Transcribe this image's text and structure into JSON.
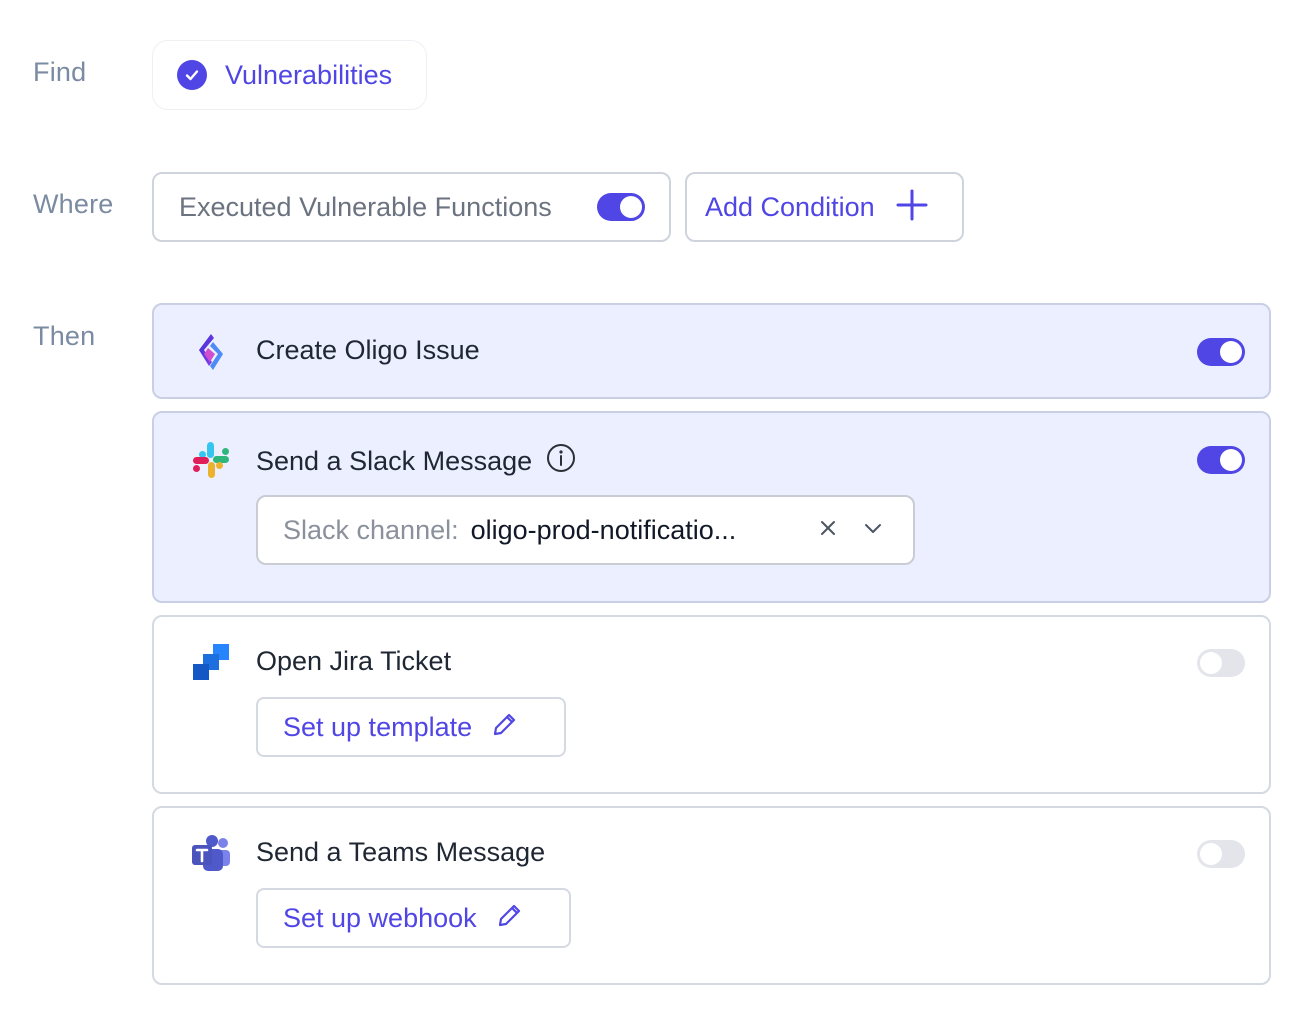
{
  "find": {
    "label": "Find",
    "chip_text": "Vulnerabilities",
    "chip_icon": "check-circle-icon"
  },
  "where": {
    "label": "Where",
    "condition_text": "Executed Vulnerable Functions",
    "condition_enabled": true,
    "add_condition_label": "Add Condition",
    "add_icon": "plus-icon"
  },
  "then": {
    "label": "Then",
    "actions": [
      {
        "title": "Create Oligo Issue",
        "icon": "oligo-logo-icon",
        "enabled": true
      },
      {
        "title": "Send a Slack Message",
        "icon": "slack-logo-icon",
        "info_icon": "info-icon",
        "enabled": true,
        "select": {
          "label": "Slack channel:",
          "value": "oligo-prod-notificatio..."
        }
      },
      {
        "title": "Open Jira Ticket",
        "icon": "jira-logo-icon",
        "enabled": false,
        "button_label": "Set up template"
      },
      {
        "title": "Send a Teams Message",
        "icon": "teams-logo-icon",
        "enabled": false,
        "button_label": "Set up webhook"
      }
    ]
  },
  "colors": {
    "accent": "#5046e5",
    "label_gray": "#7b8ba1",
    "active_card_bg": "#ebefff"
  }
}
